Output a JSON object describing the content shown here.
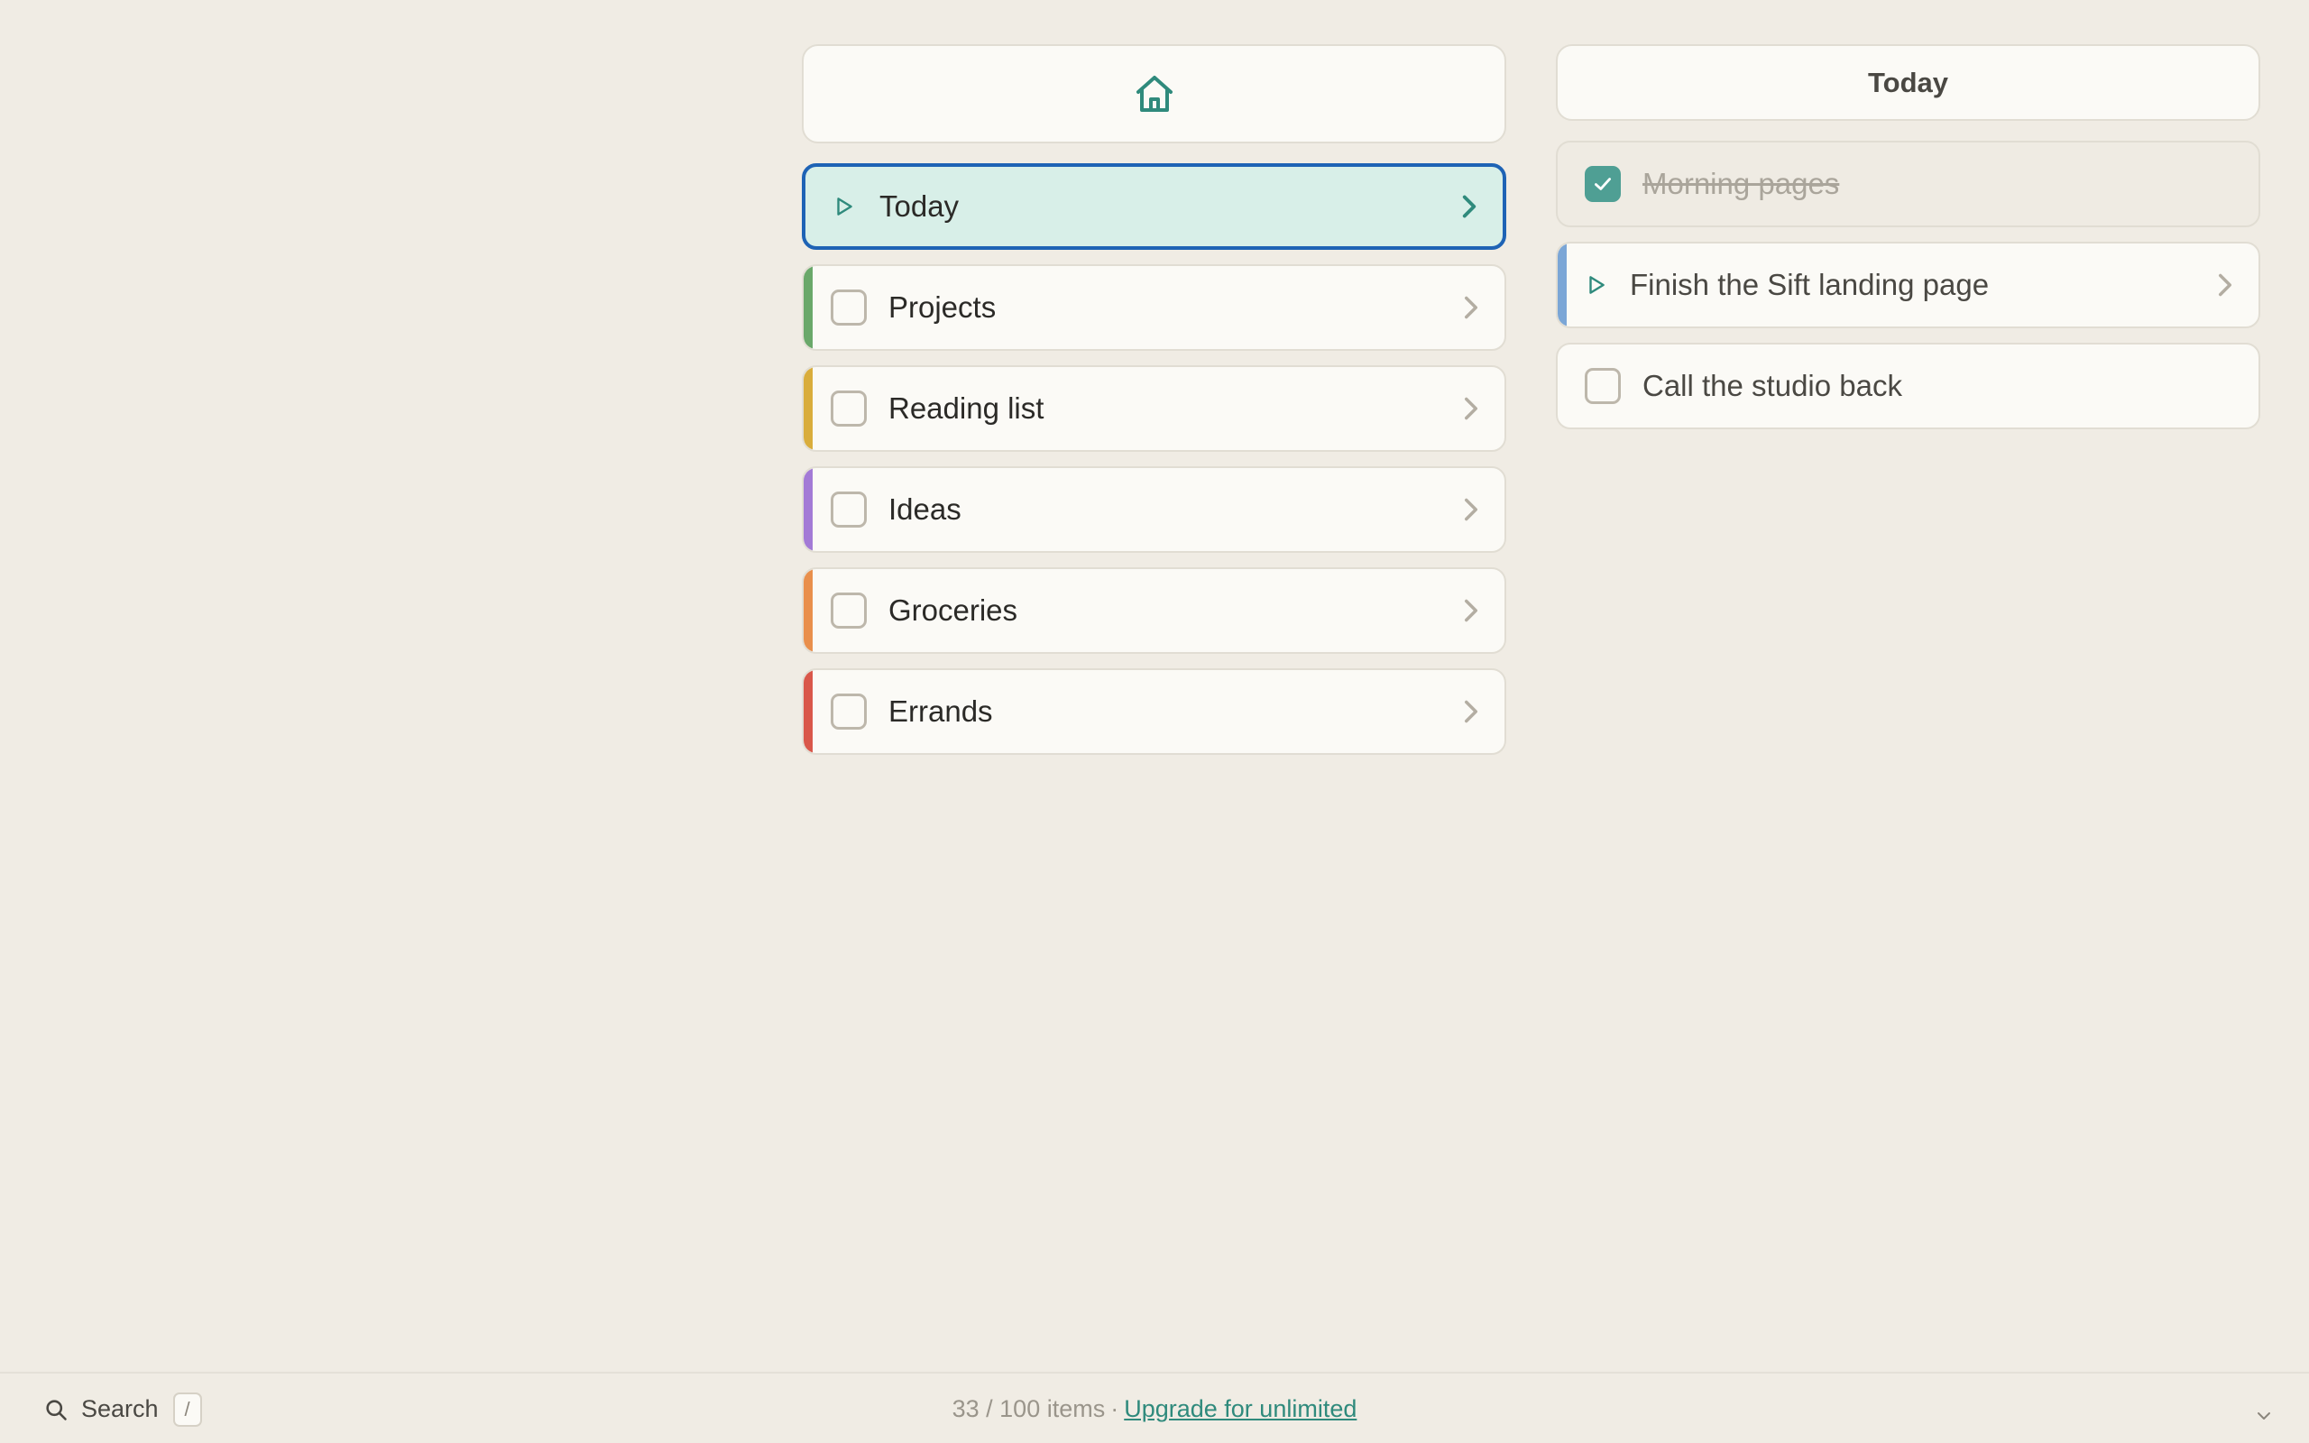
{
  "colors": {
    "accent": "#2f8a7c",
    "selected_border": "#1e63b5",
    "selected_bg": "#d8efe8",
    "stripe_projects": "#6aa86a",
    "stripe_reading": "#d9ad3c",
    "stripe_ideas": "#a37ad6",
    "stripe_groceries": "#e98f4c",
    "stripe_errands": "#d9574a",
    "stripe_task": "#7ba6d6"
  },
  "left_panel": {
    "header_icon": "home-icon",
    "lists": [
      {
        "label": "Today",
        "icon": "play-icon",
        "selected": true
      },
      {
        "label": "Projects",
        "icon": "checkbox"
      },
      {
        "label": "Reading list",
        "icon": "checkbox"
      },
      {
        "label": "Ideas",
        "icon": "checkbox"
      },
      {
        "label": "Groceries",
        "icon": "checkbox"
      },
      {
        "label": "Errands",
        "icon": "checkbox"
      }
    ]
  },
  "right_panel": {
    "title": "Today",
    "tasks": [
      {
        "label": "Morning pages",
        "done": true
      },
      {
        "label": "Finish the Sift landing page",
        "icon": "play-icon"
      },
      {
        "label": "Call the studio back",
        "done": false
      }
    ]
  },
  "footer": {
    "search_label": "Search",
    "search_shortcut": "/",
    "usage_count": "33 / 100 items",
    "separator": "·",
    "upgrade_link": "Upgrade for unlimited"
  }
}
